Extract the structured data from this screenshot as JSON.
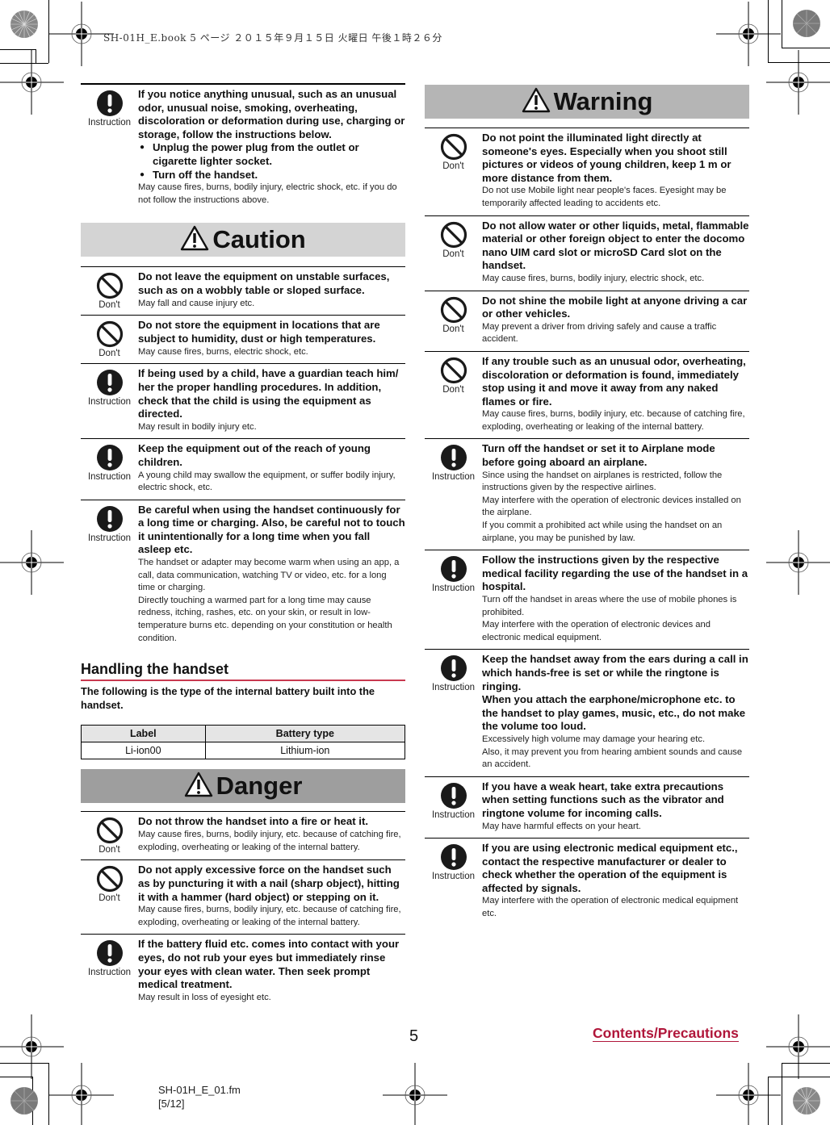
{
  "slug": "SH-01H_E.book  5 ページ  ２０１５年９月１５日  火曜日  午後１時２６分",
  "icons": {
    "instruction": "exclamation-circle-icon",
    "dont": "prohibition-icon",
    "hazard": "warning-triangle-icon"
  },
  "icon_labels": {
    "instruction": "Instruction",
    "dont": "Don't"
  },
  "left_column": {
    "top_entry": {
      "type": "instruction",
      "bold": "If you notice anything unusual, such as an unusual odor, unusual noise, smoking, overheating, discoloration or deformation during use, charging or storage, follow the instructions below.",
      "bullets": [
        "Unplug the power plug from the outlet or cigarette lighter socket.",
        "Turn off the handset."
      ],
      "normal": "May cause fires, burns, bodily injury, electric shock, etc. if you do not follow the instructions above."
    },
    "caution": {
      "title": "Caution",
      "entries": [
        {
          "type": "dont",
          "bold": "Do not leave the equipment on unstable surfaces, such as on a wobbly table or sloped surface.",
          "normal": "May fall and cause injury etc."
        },
        {
          "type": "dont",
          "bold": "Do not store the equipment in locations that are subject to humidity, dust or high temperatures.",
          "normal": "May cause fires, burns, electric shock, etc."
        },
        {
          "type": "instruction",
          "bold": "If being used by a child, have a guardian teach him/ her the proper handling procedures. In addition, check that the child is using the equipment as directed.",
          "normal": "May result in bodily injury etc."
        },
        {
          "type": "instruction",
          "bold": "Keep the equipment out of the reach of young children.",
          "normal": "A young child may swallow the equipment, or suffer bodily injury, electric shock, etc."
        },
        {
          "type": "instruction",
          "bold": "Be careful when using the handset continuously for a long time or charging. Also, be careful not to touch it unintentionally for a long time when you fall asleep etc.",
          "normal": "The handset or adapter may become warm when using an app, a call, data communication, watching TV or video, etc. for a long time or charging.\nDirectly touching a warmed part for a long time may cause redness, itching, rashes, etc. on your skin, or result in low-temperature burns etc. depending on your constitution or health condition."
        }
      ]
    },
    "handling": {
      "title": "Handling the handset",
      "intro": "The following is the type of the internal battery built into the handset.",
      "table": {
        "headers": [
          "Label",
          "Battery type"
        ],
        "rows": [
          [
            "Li-ion00",
            "Lithium-ion"
          ]
        ]
      }
    },
    "danger": {
      "title": "Danger",
      "entries": [
        {
          "type": "dont",
          "bold": "Do not throw the handset into a fire or heat it.",
          "normal": "May cause fires, burns, bodily injury, etc. because of catching fire, exploding, overheating or leaking of the internal battery."
        },
        {
          "type": "dont",
          "bold": "Do not apply excessive force on the handset such as by puncturing it with a nail (sharp object), hitting it with a hammer (hard object) or stepping on it.",
          "normal": "May cause fires, burns, bodily injury, etc. because of catching fire, exploding, overheating or leaking of the internal battery."
        },
        {
          "type": "instruction",
          "bold": "If the battery fluid etc. comes into contact with your eyes, do not rub your eyes but immediately rinse your eyes with clean water. Then seek prompt medical treatment.",
          "normal": "May result in loss of eyesight etc."
        }
      ]
    }
  },
  "right_column": {
    "warning": {
      "title": "Warning",
      "entries": [
        {
          "type": "dont",
          "bold": "Do not point the illuminated light directly at someone's eyes. Especially when you shoot still pictures or videos of young children, keep 1 m or more distance from them.",
          "normal": "Do not use Mobile light near people's faces. Eyesight may be temporarily affected leading to accidents etc."
        },
        {
          "type": "dont",
          "bold": "Do not allow water or other liquids, metal, flammable material or other foreign object to enter the docomo nano UIM card slot or microSD Card slot on the handset.",
          "normal": "May cause fires, burns, bodily injury, electric shock, etc."
        },
        {
          "type": "dont",
          "bold": "Do not shine the mobile light at anyone driving a car or other vehicles.",
          "normal": "May prevent a driver from driving safely and cause a traffic accident."
        },
        {
          "type": "dont",
          "bold": "If any trouble such as an unusual odor, overheating, discoloration or deformation is found, immediately stop using it and move it away from any naked flames or fire.",
          "normal": "May cause fires, burns, bodily injury, etc. because of catching fire, exploding, overheating or leaking of the internal battery."
        },
        {
          "type": "instruction",
          "bold": "Turn off the handset or set it to Airplane mode before going aboard an airplane.",
          "normal": "Since using the handset on airplanes is restricted, follow the instructions given by the respective airlines.\nMay interfere with the operation of electronic devices installed on the airplane.\nIf you commit a prohibited act while using the handset on an airplane, you may be punished by law."
        },
        {
          "type": "instruction",
          "bold": "Follow the instructions given by the respective medical facility regarding the use of the handset in a hospital.",
          "normal": "Turn off the handset in areas where the use of mobile phones is prohibited.\nMay interfere with the operation of electronic devices and electronic medical equipment."
        },
        {
          "type": "instruction",
          "bold": "Keep the handset away from the ears during a call in which hands-free is set or while the ringtone is ringing.\nWhen you attach the earphone/microphone etc. to the handset to play games, music, etc., do not make the volume too loud.",
          "normal": "Excessively high volume may damage your hearing etc.\nAlso, it may prevent you from hearing ambient sounds and cause an accident."
        },
        {
          "type": "instruction",
          "bold": "If you have a weak heart, take extra precautions when setting functions such as the vibrator and ringtone volume for incoming calls.",
          "normal": "May have harmful effects on your heart."
        },
        {
          "type": "instruction",
          "bold": "If you are using electronic medical equipment etc., contact the respective manufacturer or dealer to check whether the operation of the equipment is affected by signals.",
          "normal": "May interfere with the operation of electronic medical equipment etc."
        }
      ]
    }
  },
  "footer": {
    "page_number": "5",
    "section_link": "Contents/Precautions",
    "file_name": "SH-01H_E_01.fm",
    "page_range": "[5/12]"
  },
  "colors": {
    "accent": "#b0163a",
    "rule_red": "#c8384f",
    "caution_band": "#d4d4d4",
    "warning_band": "#b5b5b5",
    "danger_band": "#9e9e9e"
  }
}
